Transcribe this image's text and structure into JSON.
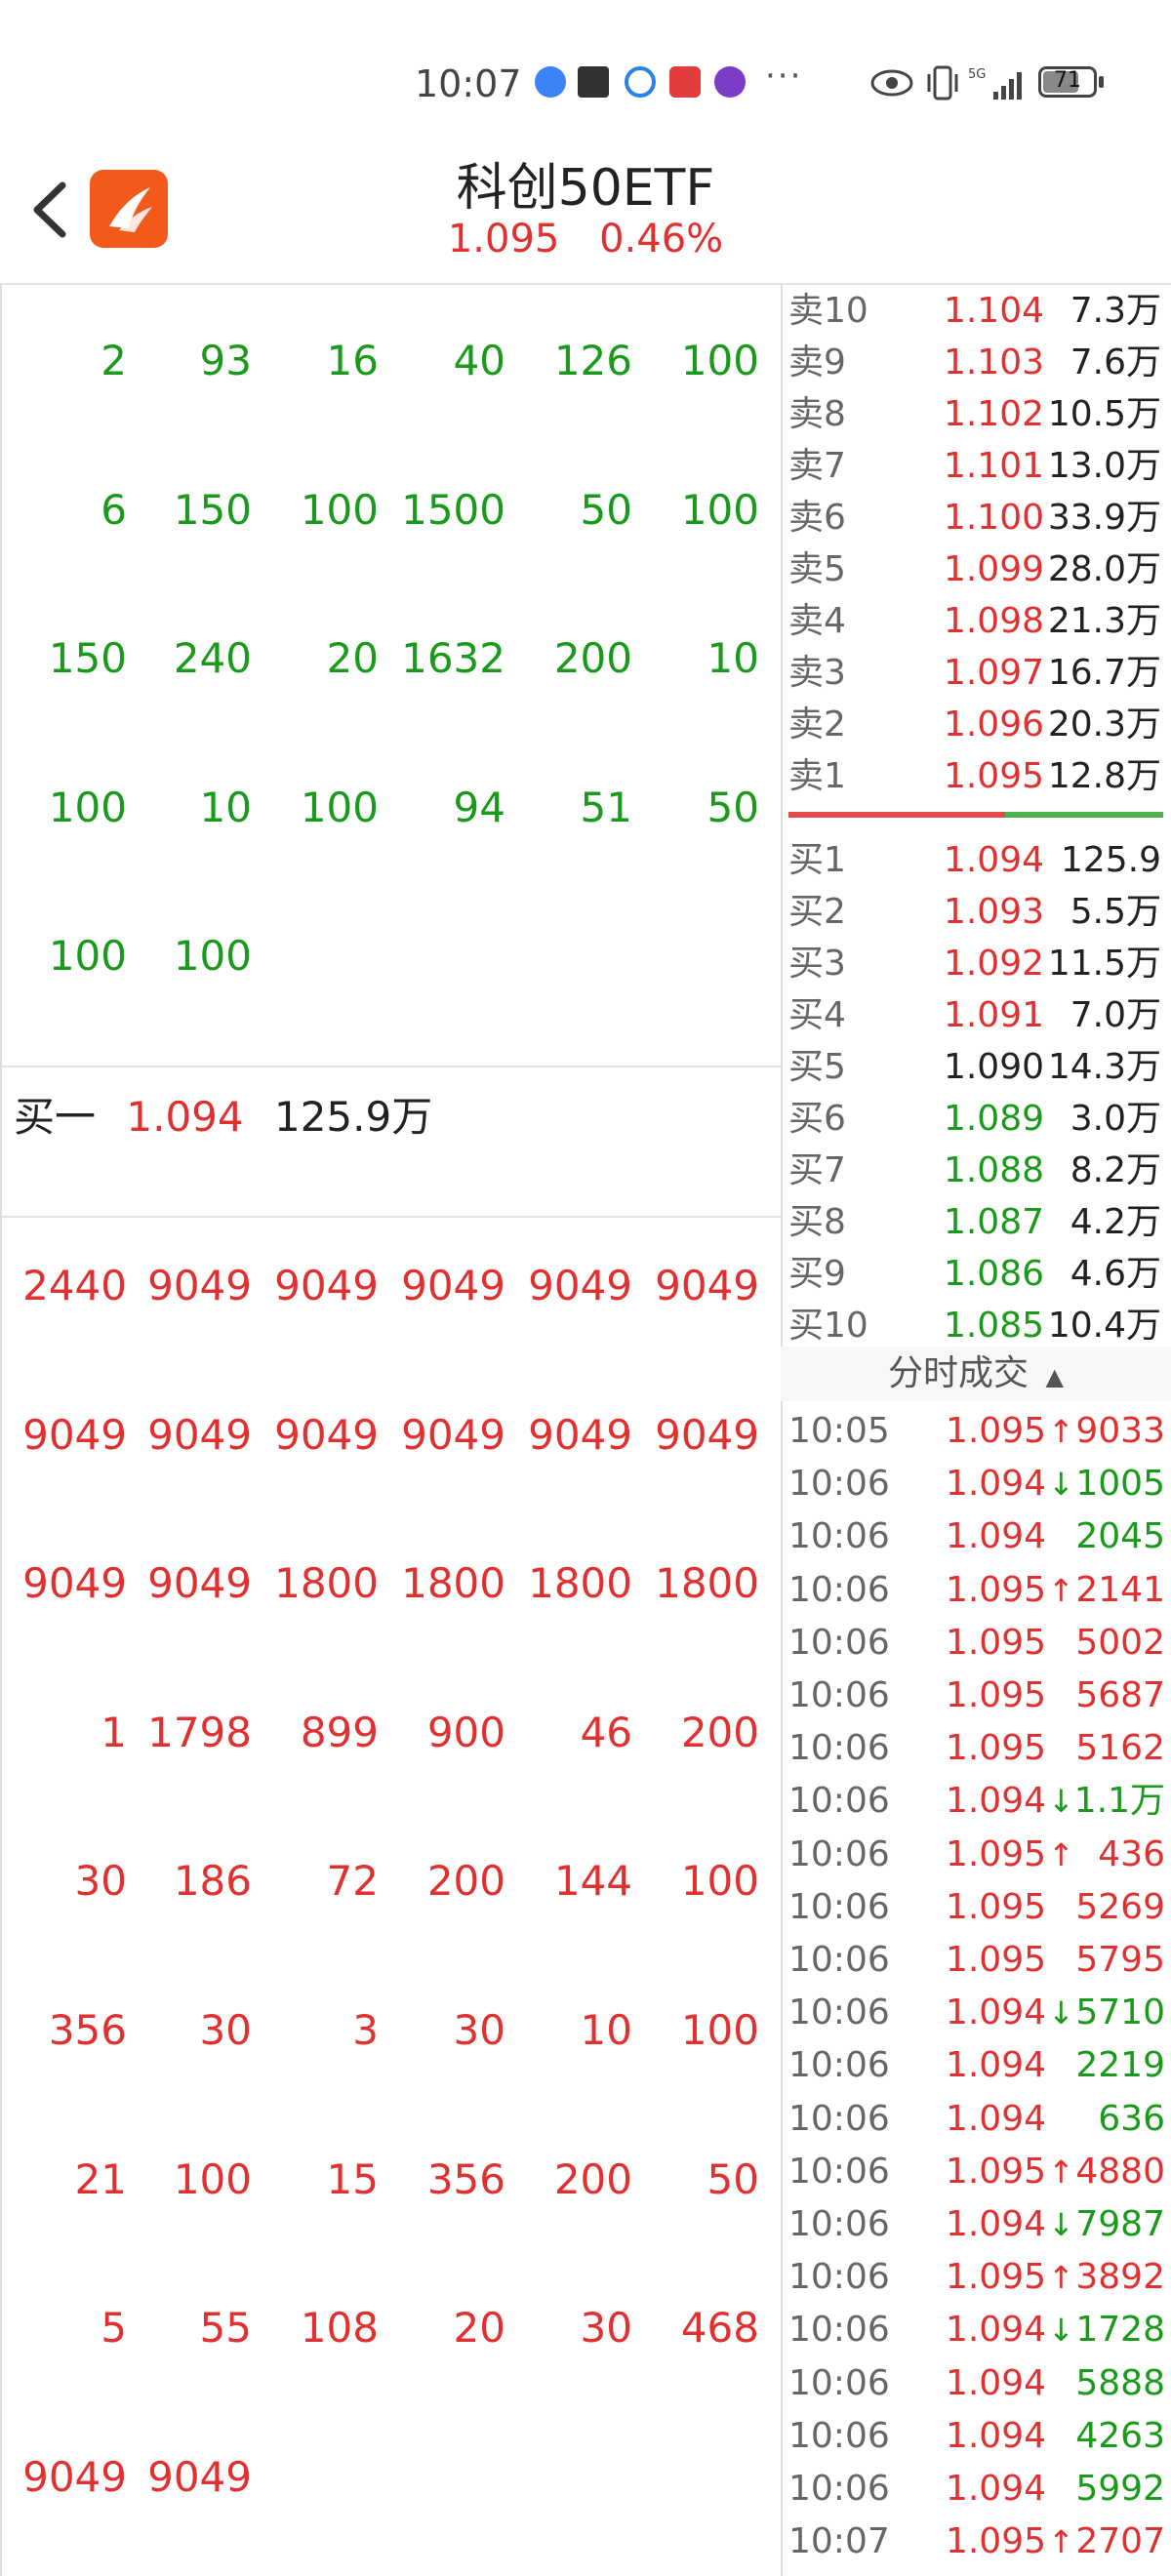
{
  "status_bar": {
    "time": "10:07",
    "more": "···",
    "battery": "71"
  },
  "header": {
    "title": "科创50ETF",
    "price": "1.095",
    "change": "0.46%"
  },
  "ask_ticks": [
    [
      "2",
      "93",
      "16",
      "40",
      "126",
      "100"
    ],
    [
      "6",
      "150",
      "100",
      "1500",
      "50",
      "100"
    ],
    [
      "150",
      "240",
      "20",
      "1632",
      "200",
      "10"
    ],
    [
      "100",
      "10",
      "100",
      "94",
      "51",
      "50"
    ],
    [
      "100",
      "100"
    ]
  ],
  "bid_one": {
    "label": "买一",
    "price": "1.094",
    "volume": "125.9万"
  },
  "bid_ticks": [
    [
      "2440",
      "9049",
      "9049",
      "9049",
      "9049",
      "9049"
    ],
    [
      "9049",
      "9049",
      "9049",
      "9049",
      "9049",
      "9049"
    ],
    [
      "9049",
      "9049",
      "1800",
      "1800",
      "1800",
      "1800"
    ],
    [
      "1",
      "1798",
      "899",
      "900",
      "46",
      "200"
    ],
    [
      "30",
      "186",
      "72",
      "200",
      "144",
      "100"
    ],
    [
      "356",
      "30",
      "3",
      "30",
      "10",
      "100"
    ],
    [
      "21",
      "100",
      "15",
      "356",
      "200",
      "50"
    ],
    [
      "5",
      "55",
      "108",
      "20",
      "30",
      "468"
    ],
    [
      "9049",
      "9049"
    ]
  ],
  "order_book": {
    "asks": [
      {
        "label": "卖10",
        "price": "1.104",
        "volume": "7.3万",
        "color": "red"
      },
      {
        "label": "卖9",
        "price": "1.103",
        "volume": "7.6万",
        "color": "red"
      },
      {
        "label": "卖8",
        "price": "1.102",
        "volume": "10.5万",
        "color": "red"
      },
      {
        "label": "卖7",
        "price": "1.101",
        "volume": "13.0万",
        "color": "red"
      },
      {
        "label": "卖6",
        "price": "1.100",
        "volume": "33.9万",
        "color": "red"
      },
      {
        "label": "卖5",
        "price": "1.099",
        "volume": "28.0万",
        "color": "red"
      },
      {
        "label": "卖4",
        "price": "1.098",
        "volume": "21.3万",
        "color": "red"
      },
      {
        "label": "卖3",
        "price": "1.097",
        "volume": "16.7万",
        "color": "red"
      },
      {
        "label": "卖2",
        "price": "1.096",
        "volume": "20.3万",
        "color": "red"
      },
      {
        "label": "卖1",
        "price": "1.095",
        "volume": "12.8万",
        "color": "red"
      }
    ],
    "bids": [
      {
        "label": "买1",
        "price": "1.094",
        "volume": "125.9万",
        "color": "red"
      },
      {
        "label": "买2",
        "price": "1.093",
        "volume": "5.5万",
        "color": "red"
      },
      {
        "label": "买3",
        "price": "1.092",
        "volume": "11.5万",
        "color": "red"
      },
      {
        "label": "买4",
        "price": "1.091",
        "volume": "7.0万",
        "color": "red"
      },
      {
        "label": "买5",
        "price": "1.090",
        "volume": "14.3万",
        "color": "black"
      },
      {
        "label": "买6",
        "price": "1.089",
        "volume": "3.0万",
        "color": "green"
      },
      {
        "label": "买7",
        "price": "1.088",
        "volume": "8.2万",
        "color": "green"
      },
      {
        "label": "买8",
        "price": "1.087",
        "volume": "4.2万",
        "color": "green"
      },
      {
        "label": "买9",
        "price": "1.086",
        "volume": "4.6万",
        "color": "green"
      },
      {
        "label": "买10",
        "price": "1.085",
        "volume": "10.4万",
        "color": "green"
      }
    ]
  },
  "trades_title": "分时成交",
  "trades": [
    {
      "time": "10:05",
      "price": "1.095",
      "dir": "up",
      "volume": "9033"
    },
    {
      "time": "10:06",
      "price": "1.094",
      "dir": "down",
      "volume": "1005"
    },
    {
      "time": "10:06",
      "price": "1.094",
      "dir": "",
      "volume": "2045"
    },
    {
      "time": "10:06",
      "price": "1.095",
      "dir": "up",
      "volume": "2141"
    },
    {
      "time": "10:06",
      "price": "1.095",
      "dir": "",
      "volume": "5002"
    },
    {
      "time": "10:06",
      "price": "1.095",
      "dir": "",
      "volume": "5687"
    },
    {
      "time": "10:06",
      "price": "1.095",
      "dir": "",
      "volume": "5162"
    },
    {
      "time": "10:06",
      "price": "1.094",
      "dir": "down",
      "volume": "1.1万"
    },
    {
      "time": "10:06",
      "price": "1.095",
      "dir": "up",
      "volume": "436"
    },
    {
      "time": "10:06",
      "price": "1.095",
      "dir": "",
      "volume": "5269"
    },
    {
      "time": "10:06",
      "price": "1.095",
      "dir": "",
      "volume": "5795"
    },
    {
      "time": "10:06",
      "price": "1.094",
      "dir": "down",
      "volume": "5710"
    },
    {
      "time": "10:06",
      "price": "1.094",
      "dir": "",
      "volume": "2219"
    },
    {
      "time": "10:06",
      "price": "1.094",
      "dir": "",
      "volume": "636"
    },
    {
      "time": "10:06",
      "price": "1.095",
      "dir": "up",
      "volume": "4880"
    },
    {
      "time": "10:06",
      "price": "1.094",
      "dir": "down",
      "volume": "7987"
    },
    {
      "time": "10:06",
      "price": "1.095",
      "dir": "up",
      "volume": "3892"
    },
    {
      "time": "10:06",
      "price": "1.094",
      "dir": "down",
      "volume": "1728"
    },
    {
      "time": "10:06",
      "price": "1.094",
      "dir": "",
      "volume": "5888"
    },
    {
      "time": "10:06",
      "price": "1.094",
      "dir": "",
      "volume": "4263"
    },
    {
      "time": "10:06",
      "price": "1.094",
      "dir": "",
      "volume": "5992"
    },
    {
      "time": "10:07",
      "price": "1.095",
      "dir": "up",
      "volume": "2707"
    }
  ]
}
